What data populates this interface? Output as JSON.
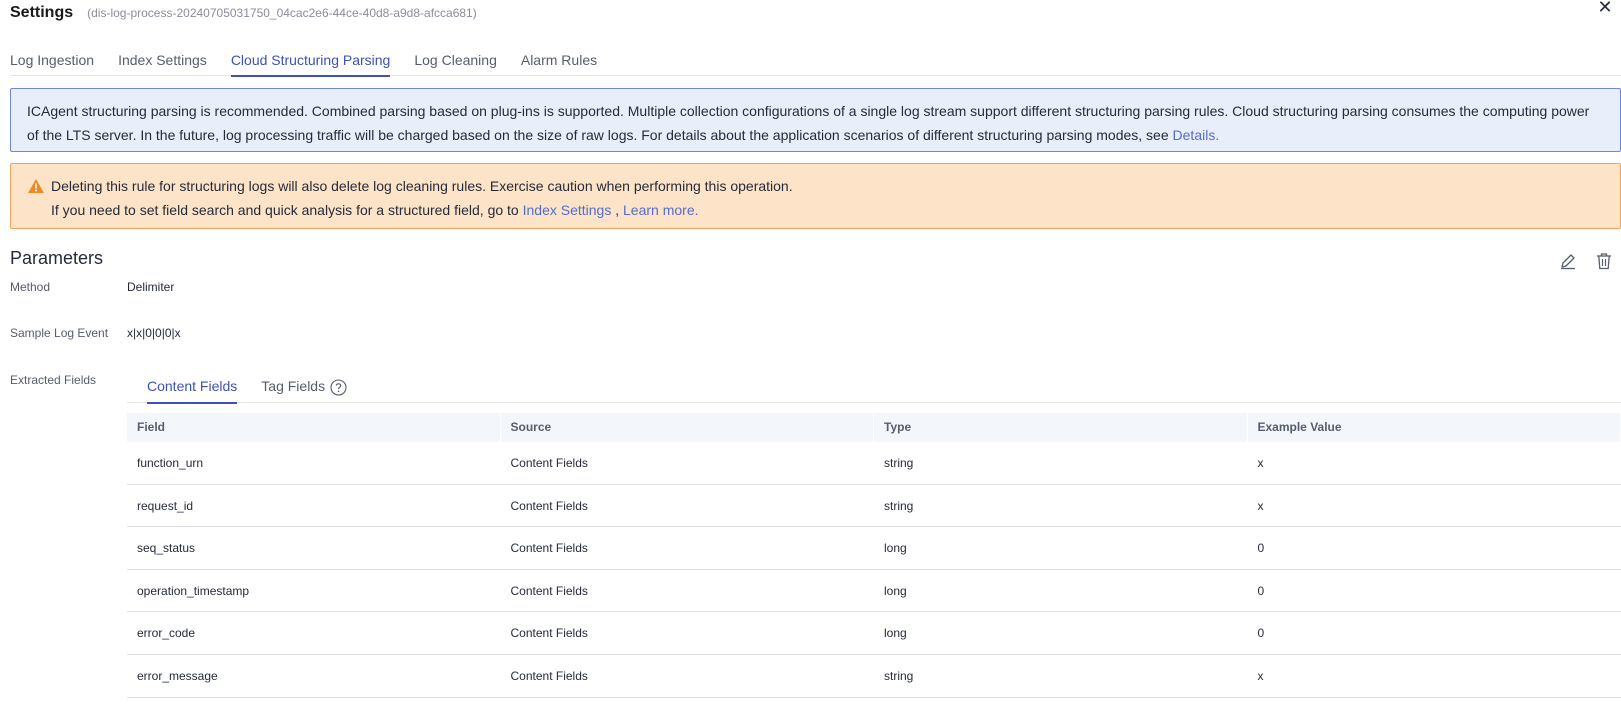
{
  "header": {
    "title": "Settings",
    "subtitle": "(dis-log-process-20240705031750_04cac2e6-44ce-40d8-a9d8-afcca681)",
    "close_glyph": "✕"
  },
  "tabs": [
    {
      "label": "Log Ingestion",
      "active": false
    },
    {
      "label": "Index Settings",
      "active": false
    },
    {
      "label": "Cloud Structuring Parsing",
      "active": true
    },
    {
      "label": "Log Cleaning",
      "active": false
    },
    {
      "label": "Alarm Rules",
      "active": false
    }
  ],
  "info": {
    "text": "ICAgent structuring parsing is recommended. Combined parsing based on plug-ins is supported. Multiple collection configurations of a single log stream support different structuring parsing rules. Cloud structuring parsing consumes the computing power of the LTS server. In the future, log processing traffic will be charged based on the size of raw logs. For details about the application scenarios of different structuring parsing modes, see ",
    "link": "Details",
    "end": "."
  },
  "warning": {
    "line1": "Deleting this rule for structuring logs will also delete log cleaning rules. Exercise caution when performing this operation.",
    "line2_prefix": "If you need to set field search and quick analysis for a structured field, go to ",
    "index_link": "Index Settings",
    "separator": " , ",
    "learn_link": "Learn more",
    "end": "."
  },
  "parameters": {
    "title": "Parameters",
    "method_label": "Method",
    "method_value": "Delimiter",
    "sample_label": "Sample Log Event",
    "sample_value": "x|x|0|0|0|x",
    "extracted_label": "Extracted Fields"
  },
  "subtabs": [
    {
      "label": "Content Fields",
      "active": true
    },
    {
      "label": "Tag Fields",
      "active": false
    }
  ],
  "table": {
    "columns": [
      "Field",
      "Source",
      "Type",
      "Example Value"
    ],
    "rows": [
      [
        "function_urn",
        "Content Fields",
        "string",
        "x"
      ],
      [
        "request_id",
        "Content Fields",
        "string",
        "x"
      ],
      [
        "seq_status",
        "Content Fields",
        "long",
        "0"
      ],
      [
        "operation_timestamp",
        "Content Fields",
        "long",
        "0"
      ],
      [
        "error_code",
        "Content Fields",
        "long",
        "0"
      ],
      [
        "error_message",
        "Content Fields",
        "string",
        "x"
      ]
    ]
  },
  "icons": {
    "close": "close-icon",
    "warning": "warning-triangle-icon",
    "edit": "pencil-icon",
    "delete": "trash-icon",
    "help": "question-circle-icon"
  },
  "colors": {
    "accent": "#3c52b9",
    "link": "#526ecc",
    "info_bg": "#e9eefb",
    "warning_bg": "#fde3c8",
    "warning_icon": "#f08a24"
  }
}
